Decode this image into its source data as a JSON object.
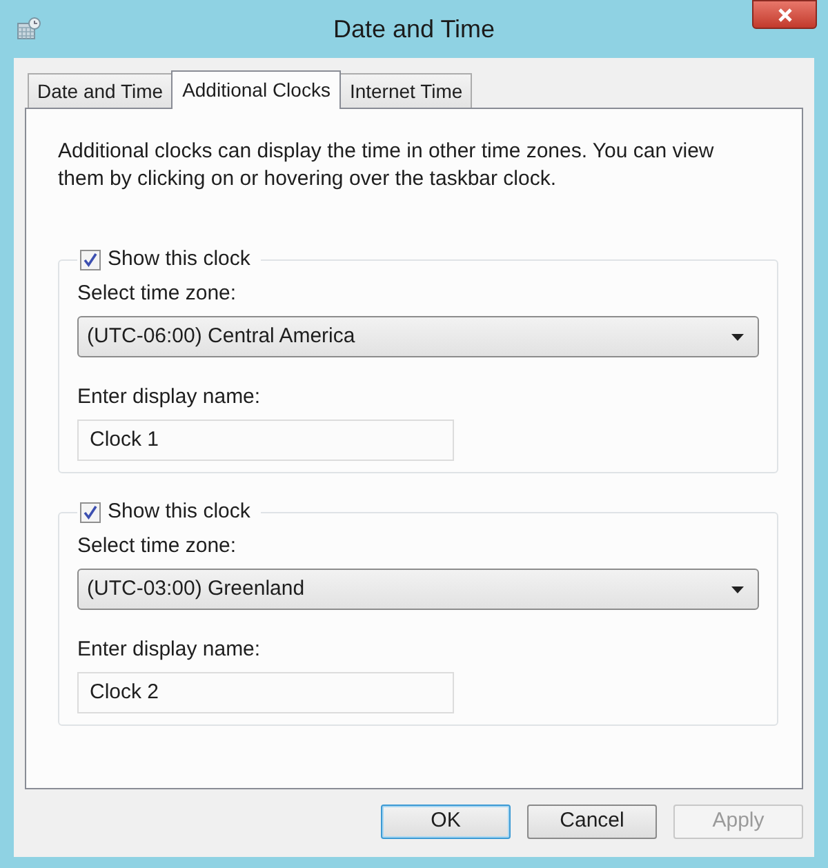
{
  "window": {
    "title": "Date and Time"
  },
  "tabs": [
    {
      "label": "Date and Time",
      "selected": false
    },
    {
      "label": "Additional Clocks",
      "selected": true
    },
    {
      "label": "Internet Time",
      "selected": false
    }
  ],
  "description": "Additional clocks can display the time in other time zones. You can view them by clicking on or hovering over the taskbar clock.",
  "clocks": [
    {
      "show_label": "Show this clock",
      "checked": true,
      "time_zone_label": "Select time zone:",
      "time_zone": "(UTC-06:00) Central America",
      "name_label": "Enter display name:",
      "display_name": "Clock 1"
    },
    {
      "show_label": "Show this clock",
      "checked": true,
      "time_zone_label": "Select time zone:",
      "time_zone": "(UTC-03:00) Greenland",
      "name_label": "Enter display name:",
      "display_name": "Clock 2"
    }
  ],
  "buttons": [
    {
      "label": "OK",
      "default": true,
      "disabled": false
    },
    {
      "label": "Cancel",
      "default": false,
      "disabled": false
    },
    {
      "label": "Apply",
      "default": false,
      "disabled": true
    }
  ]
}
